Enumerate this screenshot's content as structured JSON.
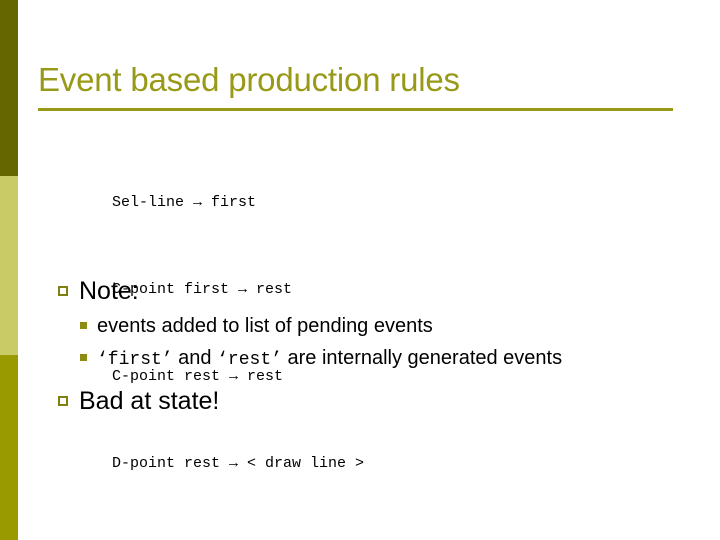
{
  "slide": {
    "title": "Event based production rules",
    "colors": {
      "title": "#999918",
      "rule": "#999918",
      "sidebar_top": "#666600",
      "sidebar_middle": "#c9cc66",
      "sidebar_bottom": "#999900",
      "bullet_marker": "#7f7f12",
      "subbullet_marker": "#8c8c14",
      "body_text": "#000000",
      "background": "#ffffff"
    },
    "rules_block": [
      "Sel-line → first",
      "C-point first → rest",
      "C-point rest → rest",
      "D-point rest → < draw line >"
    ],
    "bullets": [
      {
        "label": "Note:",
        "marker": "hollow-square-bullet",
        "sub_bullets": [
          {
            "marker": "filled-square-bullet",
            "parts": [
              {
                "type": "text",
                "value": "events added to list of pending events"
              }
            ]
          },
          {
            "marker": "filled-square-bullet",
            "parts": [
              {
                "type": "mono",
                "value": "‘first’"
              },
              {
                "type": "text",
                "value": " and "
              },
              {
                "type": "mono",
                "value": "‘rest’"
              },
              {
                "type": "text",
                "value": " are internally generated events"
              }
            ]
          }
        ]
      },
      {
        "label": "Bad at state!",
        "marker": "hollow-square-bullet",
        "sub_bullets": []
      }
    ]
  }
}
